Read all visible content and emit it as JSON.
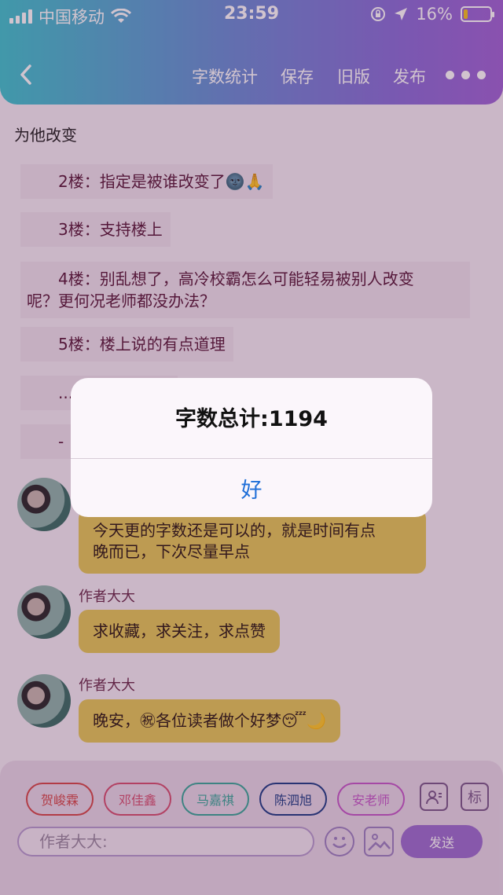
{
  "status_bar": {
    "carrier": "中国移动",
    "time": "23:59",
    "battery_percent": "16%",
    "battery_level": 0.16
  },
  "nav": {
    "back_icon": "chevron-left-icon",
    "word_count": "字数统计",
    "save": "保存",
    "old_version": "旧版",
    "publish": "发布",
    "more_icon": "ellipsis-icon"
  },
  "document": {
    "title": "为他改变",
    "floors": [
      "2楼：指定是被谁改变了🌚🙏",
      "3楼：支持楼上",
      "4楼：别乱想了，高冷校霸怎么可能轻易被别人改变",
      "呢？更何况老师都没办法？",
      "5楼：楼上说的有点道理",
      "...",
      "-"
    ]
  },
  "messages": [
    {
      "text_line1": "今天更的字数还是可以的，就是时间有点",
      "text_line2": "晚而已，下次尽量早点"
    },
    {
      "author": "作者大大",
      "text": "求收藏，求关注，求点赞"
    },
    {
      "author": "作者大大",
      "text": "晚安，㊗各位读者做个好梦😴🌙"
    }
  ],
  "toolbar": {
    "characters": [
      {
        "name": "贺峻霖",
        "color": "#d64a4a"
      },
      {
        "name": "邓佳鑫",
        "color": "#d65070"
      },
      {
        "name": "马嘉祺",
        "color": "#3aa89a"
      },
      {
        "name": "陈泗旭",
        "color": "#1e3e86"
      },
      {
        "name": "安老师",
        "color": "#c55ac8"
      }
    ],
    "tag_label": "标",
    "input_placeholder": "作者大大:",
    "send_label": "发送"
  },
  "alert": {
    "title": "字数总计:1194",
    "ok": "好"
  }
}
